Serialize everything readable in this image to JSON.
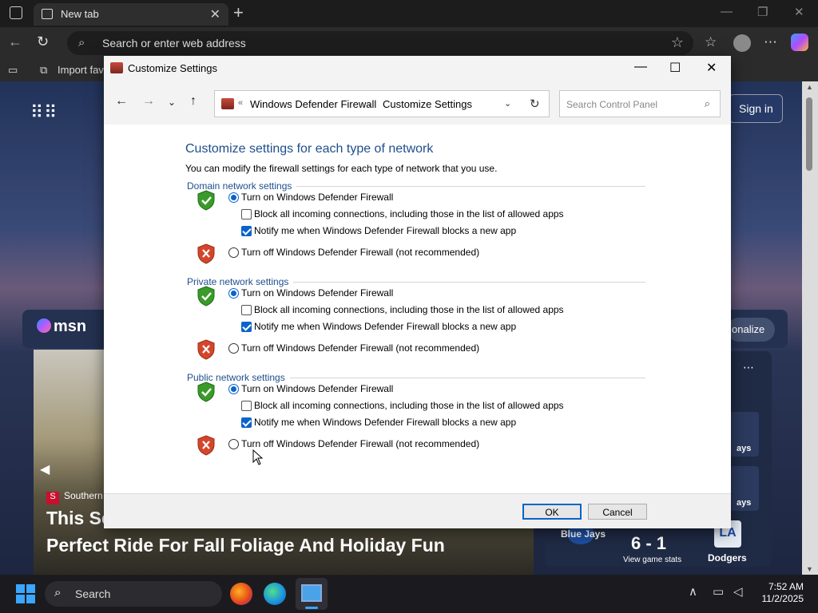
{
  "browser": {
    "tab_title": "New tab",
    "address_placeholder": "Search or enter web address",
    "favorites_item": "Import favo"
  },
  "msn_page": {
    "logo_text": "msn",
    "sign_in": "Sign in",
    "personalize": "onalize",
    "headline_source": "Southern",
    "headline_line1": "This Sc",
    "headline_line2": "Perfect Ride For Fall Foliage And Holiday Fun",
    "sports": {
      "team_left": "Blue Jays",
      "score": "6 - 1",
      "game_stats": "View game stats",
      "team_right": "Dodgers",
      "team_right_logo": "LA",
      "side_label_1": "ays",
      "side_label_2": "ays"
    }
  },
  "dialog": {
    "title": "Customize Settings",
    "breadcrumb_prefix": "«",
    "breadcrumb_parent": "Windows Defender Firewall",
    "breadcrumb_separator": "›",
    "breadcrumb_current": "Customize Settings",
    "search_placeholder": "Search Control Panel",
    "heading": "Customize settings for each type of network",
    "description": "You can modify the firewall settings for each type of network that you use.",
    "sections": [
      {
        "header": "Domain network settings",
        "turn_on_label": "Turn on Windows Defender Firewall",
        "turn_on_selected": true,
        "block_label": "Block all incoming connections, including those in the list of allowed apps",
        "block_checked": false,
        "notify_label": "Notify me when Windows Defender Firewall blocks a new app",
        "notify_checked": true,
        "turn_off_label": "Turn off Windows Defender Firewall (not recommended)",
        "turn_off_selected": false
      },
      {
        "header": "Private network settings",
        "turn_on_label": "Turn on Windows Defender Firewall",
        "turn_on_selected": true,
        "block_label": "Block all incoming connections, including those in the list of allowed apps",
        "block_checked": false,
        "notify_label": "Notify me when Windows Defender Firewall blocks a new app",
        "notify_checked": true,
        "turn_off_label": "Turn off Windows Defender Firewall (not recommended)",
        "turn_off_selected": false
      },
      {
        "header": "Public network settings",
        "turn_on_label": "Turn on Windows Defender Firewall",
        "turn_on_selected": true,
        "block_label": "Block all incoming connections, including those in the list of allowed apps",
        "block_checked": false,
        "notify_label": "Notify me when Windows Defender Firewall blocks a new app",
        "notify_checked": true,
        "turn_off_label": "Turn off Windows Defender Firewall (not recommended)",
        "turn_off_selected": false
      }
    ],
    "ok_label": "OK",
    "cancel_label": "Cancel"
  },
  "taskbar": {
    "search_label": "Search",
    "time": "7:52 AM",
    "date": "11/2/2025"
  },
  "colors": {
    "accent": "#0a64c9",
    "heading_blue": "#1e4e8c",
    "shield_green": "#3a9a2a",
    "shield_red": "#d4462c"
  },
  "icons": {
    "shield_on": "shield-check-icon",
    "shield_off": "shield-x-icon"
  }
}
